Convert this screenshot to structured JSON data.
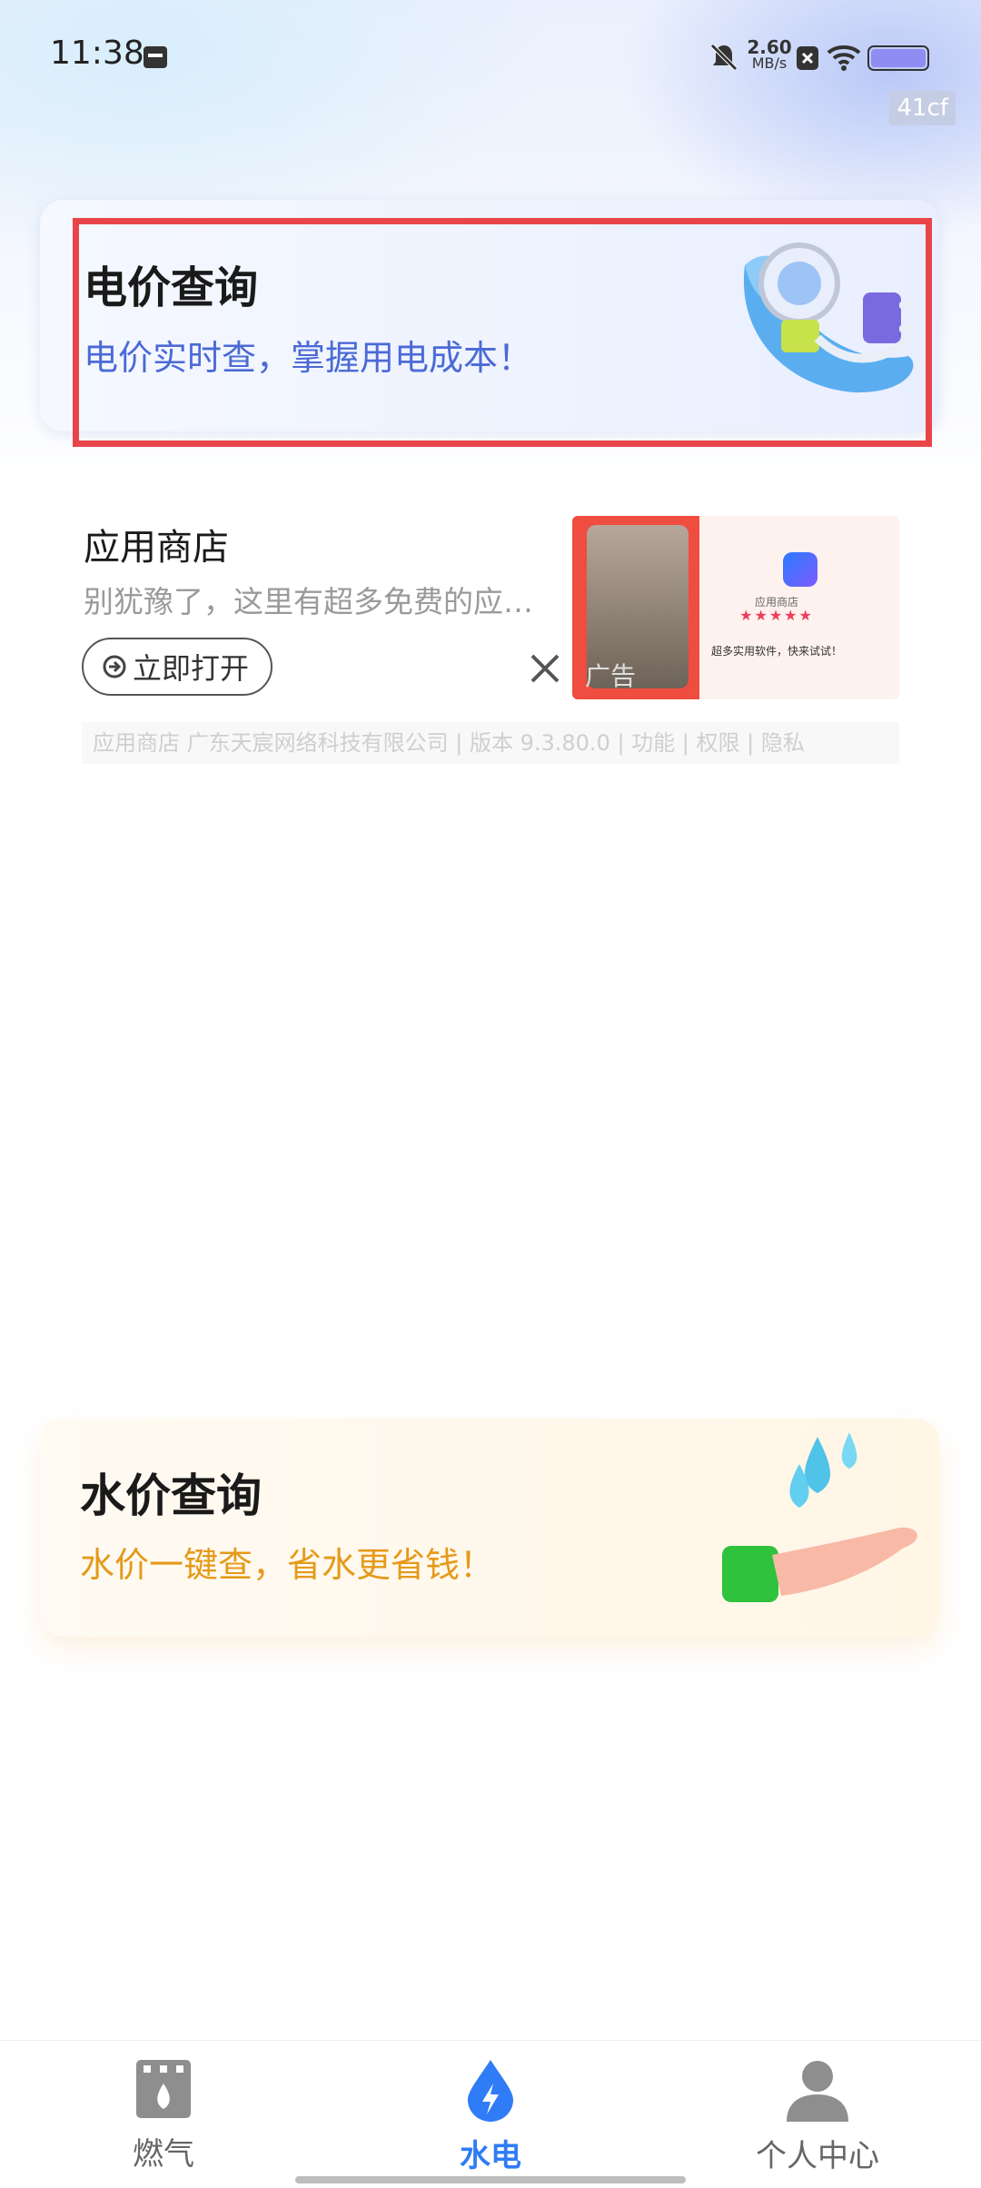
{
  "status_bar": {
    "time": "11:38",
    "network_speed_value": "2.60",
    "network_speed_unit": "MB/s",
    "build_tag": "41cf"
  },
  "electricity_card": {
    "title": "电价查询",
    "subtitle": "电价实时查，掌握用电成本！"
  },
  "ad": {
    "app_name": "应用商店",
    "description": "别犹豫了，这里有超多免费的应…",
    "open_button": "立即打开",
    "tag": "广告",
    "image_store_name": "应用商店",
    "image_stars": "★★★★★",
    "image_slogan": "超多实用软件，快来试试！",
    "footer": "应用商店 广东天宸网络科技有限公司 | 版本 9.3.80.0 | 功能 | 权限 | 隐私"
  },
  "water_card": {
    "title": "水价查询",
    "subtitle": "水价一键查，省水更省钱！"
  },
  "tabs": [
    {
      "label": "燃气",
      "icon": "gas-stove-icon",
      "active": false
    },
    {
      "label": "水电",
      "icon": "water-electric-icon",
      "active": true
    },
    {
      "label": "个人中心",
      "icon": "user-icon",
      "active": false
    }
  ],
  "colors": {
    "active_tab": "#2f7cf6",
    "inactive_tab": "#666666",
    "electric_subtitle": "#4c6ad6",
    "water_subtitle": "#e59a1a",
    "highlight_border": "#e8454a"
  }
}
